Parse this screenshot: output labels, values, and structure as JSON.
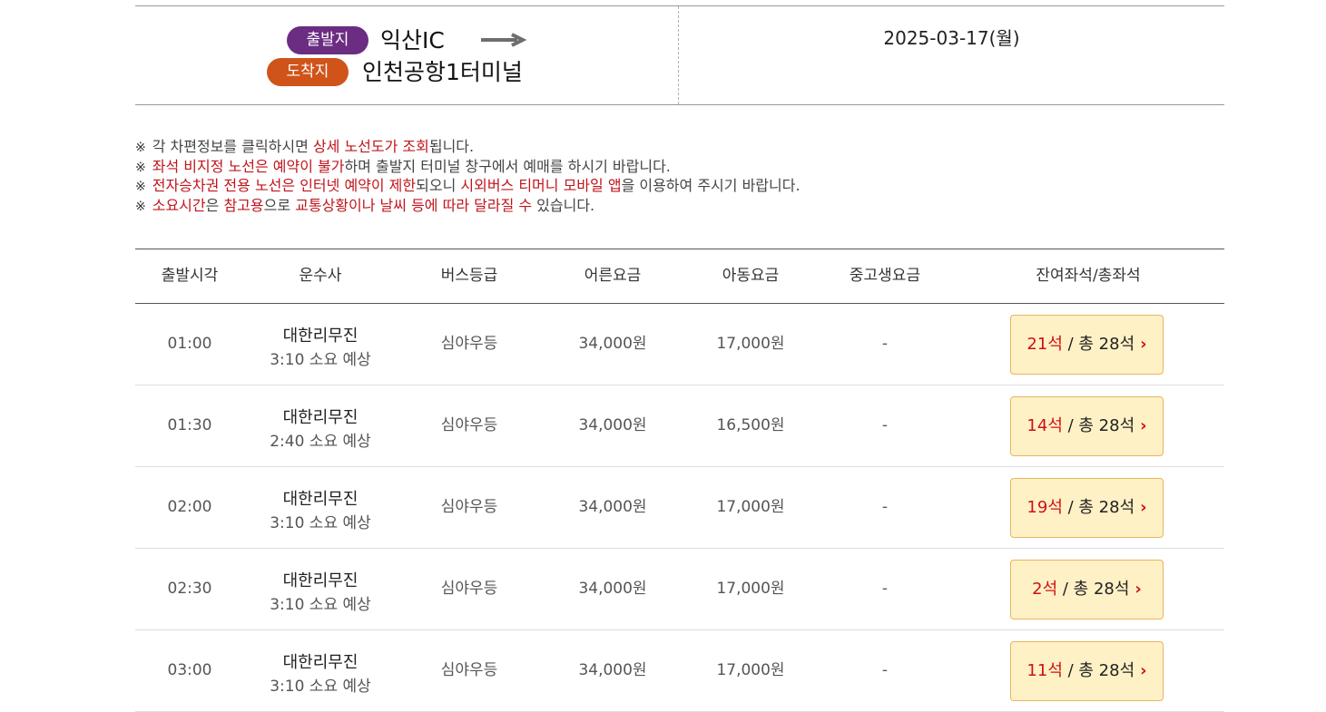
{
  "route": {
    "departure_badge": "출발지",
    "departure": "익산IC",
    "arrival_badge": "도착지",
    "arrival": "인천공항1터미널",
    "date": "2025-03-17(월)",
    "colors": {
      "departure_badge": "#6b2d82",
      "arrival_badge": "#d0541a"
    }
  },
  "notices": [
    {
      "mark": "※",
      "parts": [
        {
          "text": "각 차편정보를 클릭하시면 ",
          "hl": false
        },
        {
          "text": "상세 노선도가 조회",
          "hl": true
        },
        {
          "text": "됩니다.",
          "hl": false
        }
      ]
    },
    {
      "mark": "※",
      "parts": [
        {
          "text": "좌석 비지정 노선은 예약이 불가",
          "hl": true
        },
        {
          "text": "하며 출발지 터미널 창구에서 예매를 하시기 바랍니다.",
          "hl": false
        }
      ]
    },
    {
      "mark": "※",
      "parts": [
        {
          "text": "전자승차권 전용 노선은 인터넷 예약이 제한",
          "hl": true
        },
        {
          "text": "되오니 ",
          "hl": false
        },
        {
          "text": "시외버스 티머니 모바일 앱",
          "hl": true
        },
        {
          "text": "을 이용하여 주시기 바랍니다.",
          "hl": false
        }
      ]
    },
    {
      "mark": "※",
      "parts": [
        {
          "text": "소요시간",
          "hl": true
        },
        {
          "text": "은 ",
          "hl": false
        },
        {
          "text": "참고용",
          "hl": true
        },
        {
          "text": "으로 ",
          "hl": false
        },
        {
          "text": "교통상황이나 날씨 등에 따라 달라질 수",
          "hl": true
        },
        {
          "text": " 있습니다.",
          "hl": false
        }
      ]
    }
  ],
  "table": {
    "headers": {
      "time": "출발시각",
      "company": "운수사",
      "grade": "버스등급",
      "adult": "어른요금",
      "child": "아동요금",
      "student": "중고생요금",
      "seats": "잔여좌석/총좌석"
    },
    "rows": [
      {
        "time": "01:00",
        "company": "대한리무진",
        "duration": "3:10 소요 예상",
        "grade": "심야우등",
        "adult": "34,000원",
        "child": "17,000원",
        "student": "-",
        "remaining": "21석",
        "total": " / 총 28석"
      },
      {
        "time": "01:30",
        "company": "대한리무진",
        "duration": "2:40 소요 예상",
        "grade": "심야우등",
        "adult": "34,000원",
        "child": "16,500원",
        "student": "-",
        "remaining": "14석",
        "total": " / 총 28석"
      },
      {
        "time": "02:00",
        "company": "대한리무진",
        "duration": "3:10 소요 예상",
        "grade": "심야우등",
        "adult": "34,000원",
        "child": "17,000원",
        "student": "-",
        "remaining": "19석",
        "total": " / 총 28석"
      },
      {
        "time": "02:30",
        "company": "대한리무진",
        "duration": "3:10 소요 예상",
        "grade": "심야우등",
        "adult": "34,000원",
        "child": "17,000원",
        "student": "-",
        "remaining": "2석",
        "total": " / 총 28석"
      },
      {
        "time": "03:00",
        "company": "대한리무진",
        "duration": "3:10 소요 예상",
        "grade": "심야우등",
        "adult": "34,000원",
        "child": "17,000원",
        "student": "-",
        "remaining": "11석",
        "total": " / 총 28석"
      }
    ]
  }
}
